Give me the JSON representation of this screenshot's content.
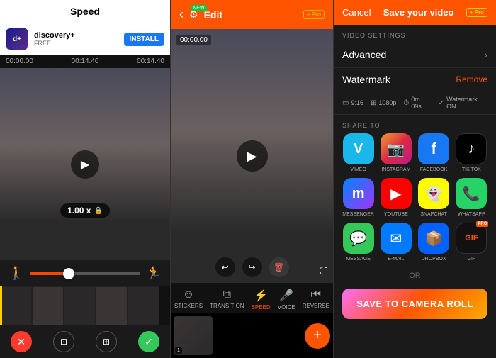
{
  "leftPanel": {
    "title": "Speed",
    "ad": {
      "appName": "discovery+",
      "subText": "FREE",
      "installLabel": "INSTALL"
    },
    "timeline": {
      "start": "00:00.00",
      "mid": "00:14.40",
      "end": "00:14.40"
    },
    "speedBadge": "1.00 x",
    "tools": {
      "undo": "↩",
      "redo": "↪",
      "delete": "🗑",
      "fullscreen": "⛶"
    },
    "bottomTools": {
      "cancel": "✕",
      "crop": "⊡",
      "resize": "⊞",
      "confirm": "✓"
    }
  },
  "middlePanel": {
    "header": {
      "backArrow": "‹",
      "gearLabel": "⚙",
      "newBadge": "NEW",
      "editLabel": "Edit",
      "proLabel": "+ Pro"
    },
    "timestamp": "00:00.00",
    "navItems": [
      {
        "label": "STICKERS",
        "icon": "☺"
      },
      {
        "label": "TRANSITION",
        "icon": "⧉"
      },
      {
        "label": "SPEED",
        "icon": "⚡"
      },
      {
        "label": "VOICE",
        "icon": "🎤"
      },
      {
        "label": "REVERSE",
        "icon": "⏮"
      }
    ],
    "addLabel": "+"
  },
  "rightPanel": {
    "header": {
      "cancelLabel": "Cancel",
      "saveLabel": "Save your video",
      "proLabel": "+ Pro"
    },
    "videoSettings": {
      "sectionTitle": "VIDEO SETTINGS",
      "advancedLabel": "Advanced",
      "watermarkLabel": "Watermark",
      "removeLabel": "Remove"
    },
    "meta": {
      "ratio": "9:16",
      "resolution": "1080p",
      "duration": "0m 09s",
      "watermark": "Watermark ON"
    },
    "shareTo": {
      "sectionTitle": "SHARE TO",
      "apps": [
        {
          "label": "VIMEO",
          "icon": "V",
          "class": "icon-vimeo"
        },
        {
          "label": "INSTAGRAM",
          "icon": "📷",
          "class": "icon-instagram"
        },
        {
          "label": "FACEBOOK",
          "icon": "f",
          "class": "icon-facebook"
        },
        {
          "label": "TIK TOK",
          "icon": "♪",
          "class": "icon-tiktok"
        },
        {
          "label": "MESSENGER",
          "icon": "m",
          "class": "icon-messenger"
        },
        {
          "label": "YOUTUBE",
          "icon": "▶",
          "class": "icon-youtube"
        },
        {
          "label": "SNAPCHAT",
          "icon": "👻",
          "class": "icon-snapchat"
        },
        {
          "label": "WHATSAPP",
          "icon": "📞",
          "class": "icon-whatsapp"
        },
        {
          "label": "MESSAGE",
          "icon": "💬",
          "class": "icon-message"
        },
        {
          "label": "E-MAIL",
          "icon": "✉",
          "class": "icon-email"
        },
        {
          "label": "DROPBOX",
          "icon": "📦",
          "class": "icon-dropbox"
        },
        {
          "label": "GIF",
          "icon": "GIF",
          "class": "icon-gif"
        }
      ]
    },
    "orLabel": "OR",
    "saveButton": "SAVE TO CAMERA ROLL"
  }
}
